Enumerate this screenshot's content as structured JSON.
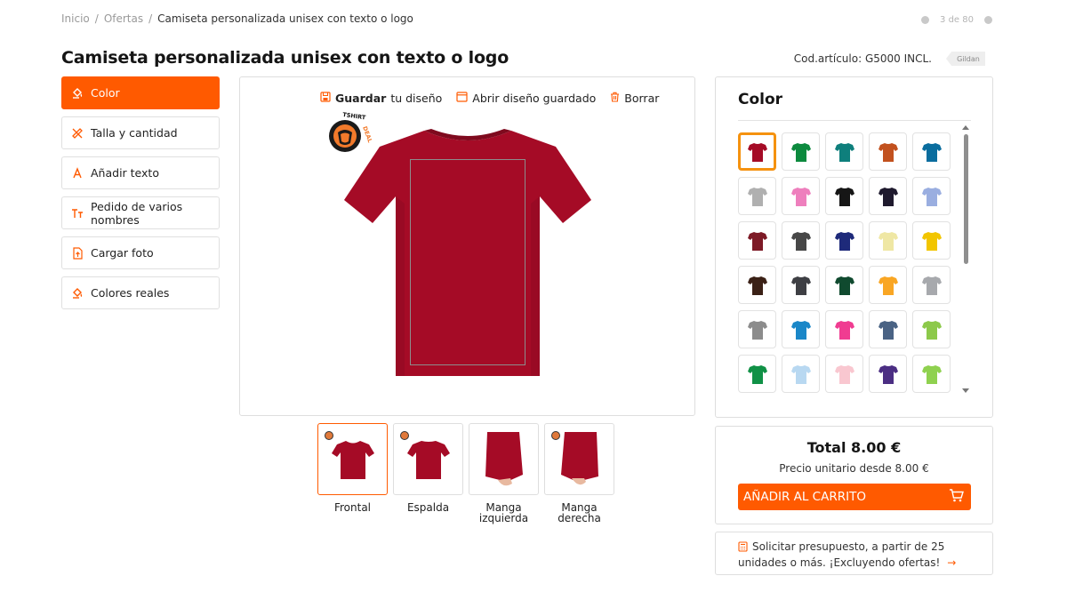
{
  "breadcrumb": {
    "home": "Inicio",
    "sep": "/",
    "offers": "Ofertas",
    "current": "Camiseta personalizada unisex con texto o logo"
  },
  "pager": {
    "text": "3 de 80"
  },
  "product": {
    "title": "Camiseta personalizada unisex con texto o logo",
    "article_code": "Cod.artículo: G5000 INCL.",
    "brand": "Gildan"
  },
  "menu": {
    "items": [
      {
        "label": "Color",
        "icon": "paint-bucket-icon"
      },
      {
        "label": "Talla y cantidad",
        "icon": "ruler-icon"
      },
      {
        "label": "Añadir texto",
        "icon": "text-a-icon"
      },
      {
        "label": "Pedido de varios nombres",
        "icon": "text-size-icon"
      },
      {
        "label": "Cargar foto",
        "icon": "upload-file-icon"
      },
      {
        "label": "Colores reales",
        "icon": "paint-bucket-icon"
      }
    ]
  },
  "toolbar": {
    "save_bold": "Guardar",
    "save_rest": "tu diseño",
    "open": "Abrir diseño guardado",
    "delete": "Borrar"
  },
  "design": {
    "stamp_text": "TSHIRTDEAL",
    "shirt_color": "#a50b26"
  },
  "views": [
    {
      "label": "Frontal"
    },
    {
      "label": "Espalda"
    },
    {
      "label": "Manga izquierda"
    },
    {
      "label": "Manga derecha"
    }
  ],
  "colors": {
    "title": "Color",
    "swatches": [
      "#a50b26",
      "#0c8a3e",
      "#0e7f7c",
      "#c2511e",
      "#0a6d9e",
      "#b0b0b0",
      "#ee7fbd",
      "#161616",
      "#1f1a2e",
      "#9aaee0",
      "#7d1a26",
      "#474747",
      "#1e2a7a",
      "#efe7a4",
      "#f2c500",
      "#3b2116",
      "#3e3f44",
      "#104a2f",
      "#f9a624",
      "#a7a9ad",
      "#8c8c8c",
      "#1a87c8",
      "#f03c91",
      "#4a6384",
      "#8cc94a",
      "#109146",
      "#b8d8f1",
      "#f9c7d0",
      "#4b2e83",
      "#8fd14f"
    ],
    "selected_index": 0
  },
  "summary": {
    "total_label": "Total",
    "total_value": "8.00 €",
    "unit_price": "Precio unitario desde 8.00 €",
    "cart_button": "AÑADIR AL CARRITO"
  },
  "quote": {
    "text": "Solicitar presupuesto, a partir de 25 unidades o más. ¡Excluyendo ofertas!",
    "arrow": "→"
  },
  "accent": "#ff5a00"
}
